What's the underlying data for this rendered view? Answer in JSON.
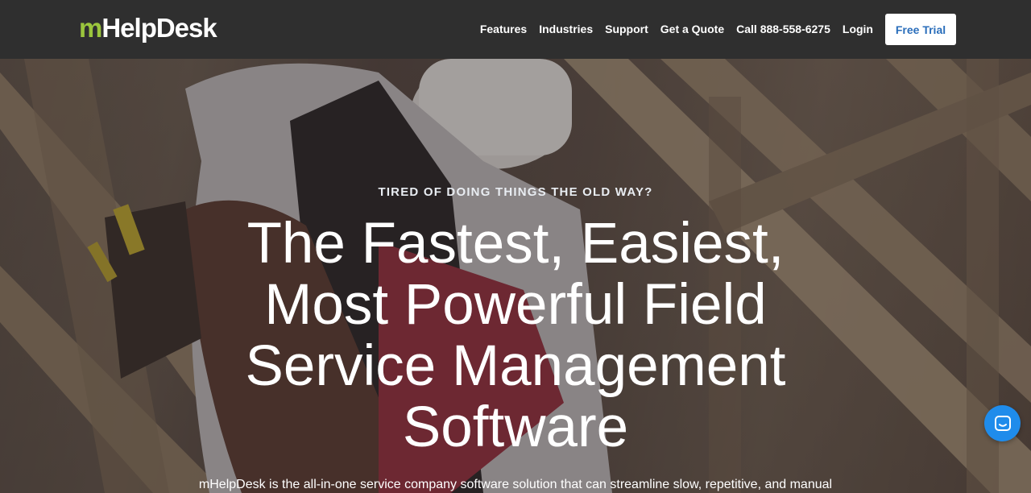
{
  "brand": {
    "logo_prefix": "m",
    "logo_rest": "HelpDesk",
    "accent_color": "#9bc53d",
    "nav_background": "#2f2f2f",
    "button_text_color": "#2a6ebb"
  },
  "nav": {
    "items": [
      {
        "label": "Features"
      },
      {
        "label": "Industries"
      },
      {
        "label": "Support"
      },
      {
        "label": "Get a Quote"
      },
      {
        "label": "Call 888-558-6275"
      },
      {
        "label": "Login"
      }
    ],
    "cta_label": "Free Trial"
  },
  "hero": {
    "eyebrow": "TIRED OF DOING THINGS THE OLD WAY?",
    "headline": "The Fastest, Easiest, Most Powerful Field Service Management Software",
    "subtext": "mHelpDesk is the all-in-one service company software solution that can streamline slow, repetitive, and manual"
  },
  "chat": {
    "icon": "chat-icon",
    "color": "#1f8ceb"
  }
}
